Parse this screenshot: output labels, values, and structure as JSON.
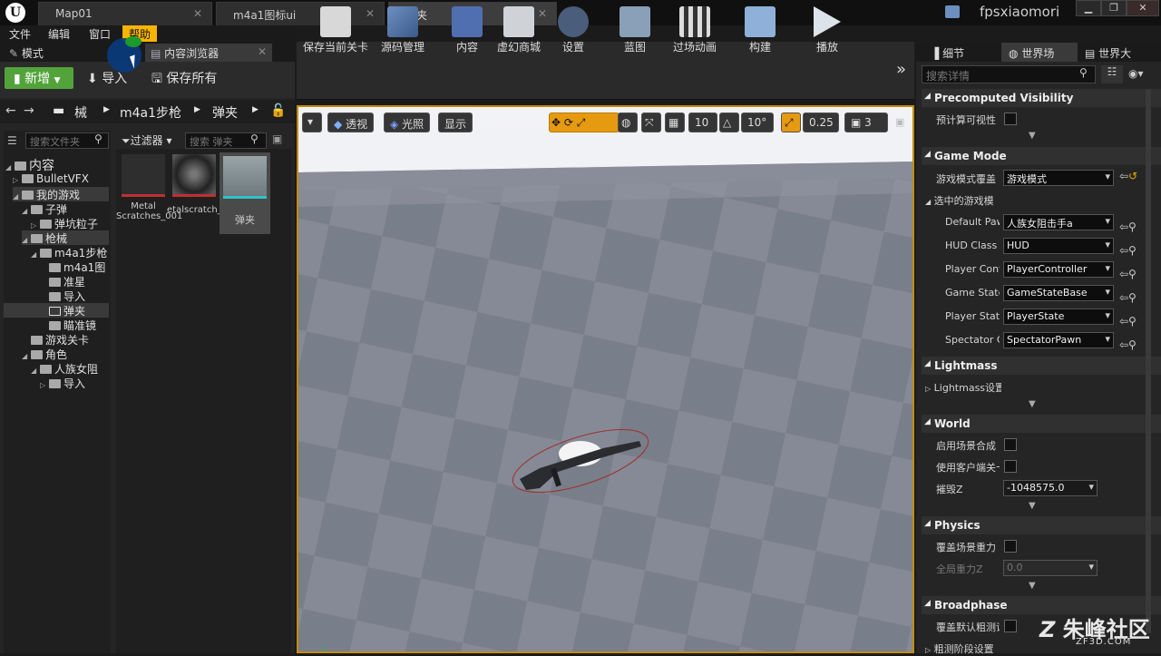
{
  "window": {
    "tabs": [
      {
        "label": "Map01"
      },
      {
        "label": "m4a1图标ui"
      },
      {
        "label": "弹夹"
      }
    ],
    "user": "fpsxiaomori"
  },
  "menu": {
    "items": [
      "文件",
      "编辑",
      "窗口",
      "帮助"
    ]
  },
  "left_panel": {
    "tab_modes": "模式",
    "tab_content": "内容浏览器",
    "new_btn": "新增",
    "import_btn": "导入",
    "save_all_btn": "保存所有",
    "breadcrumb": [
      "械",
      "m4a1步枪",
      "弹夹"
    ],
    "search_folders": "搜索文件夹",
    "filters": "过滤器",
    "search_assets": "搜索 弹夹",
    "tree": [
      {
        "label": "内容"
      },
      {
        "label": "BulletVFX"
      },
      {
        "label": "我的游戏"
      },
      {
        "label": "子弹"
      },
      {
        "label": "弹坑粒子"
      },
      {
        "label": "枪械"
      },
      {
        "label": "m4a1步枪"
      },
      {
        "label": "m4a1图"
      },
      {
        "label": "准星"
      },
      {
        "label": "导入"
      },
      {
        "label": "弹夹"
      },
      {
        "label": "瞄准镜"
      },
      {
        "label": "游戏关卡"
      },
      {
        "label": "角色"
      },
      {
        "label": "人族女阻"
      },
      {
        "label": "导入"
      }
    ],
    "assets": [
      {
        "label": "Metal Scratches_001"
      },
      {
        "label": "etalscratch_002"
      },
      {
        "label": "弹夹"
      }
    ]
  },
  "toolbar": {
    "items": [
      {
        "label": "保存当前关卡"
      },
      {
        "label": "源码管理"
      },
      {
        "label": "内容"
      },
      {
        "label": "虚幻商城"
      },
      {
        "label": "设置"
      },
      {
        "label": "蓝图"
      },
      {
        "label": "过场动画"
      },
      {
        "label": "构建"
      },
      {
        "label": "播放"
      }
    ]
  },
  "viewport": {
    "perspective": "透视",
    "lit": "光照",
    "show": "显示",
    "grid_snap": "10",
    "rot_snap": "10°",
    "scale_snap": "0.25",
    "cam_speed": "3"
  },
  "details": {
    "tabs": [
      "细节",
      "世界场",
      "世界大"
    ],
    "search_placeholder": "搜索详情",
    "sections": {
      "precomputed": "Precomputed Visibility",
      "game_mode": "Game Mode",
      "lightmass": "Lightmass",
      "world": "World",
      "physics": "Physics",
      "broadphase": "Broadphase"
    },
    "labels": {
      "precompute_vis": "预计算可视性",
      "gm_override": "游戏模式覆盖",
      "selected_gm": "选中的游戏模",
      "default_pawn": "Default Paw",
      "hud": "HUD Class",
      "player_cont": "Player Cont",
      "game_state": "Game State",
      "player_state": "Player State",
      "spectator": "Spectator C",
      "lightmass_settings": "Lightmass设置",
      "enable_comp": "启用场景合成",
      "client_side": "使用客户端关卡",
      "kill_z": "摧毁Z",
      "override_gravity": "覆盖场景重力",
      "global_gravity": "全局重力Z",
      "override_broadphase": "覆盖默认粗测设",
      "broadphase_settings": "粗测阶段设置"
    },
    "values": {
      "gm_override": "游戏模式",
      "default_pawn": "人族女阻击手a",
      "hud": "HUD",
      "player_cont": "PlayerController",
      "game_state": "GameStateBase",
      "player_state": "PlayerState",
      "spectator": "SpectatorPawn",
      "kill_z": "-1048575.0",
      "global_gravity": "0.0"
    }
  },
  "watermark": "朱峰社区",
  "watermark_sub": "ZF3D.COM"
}
